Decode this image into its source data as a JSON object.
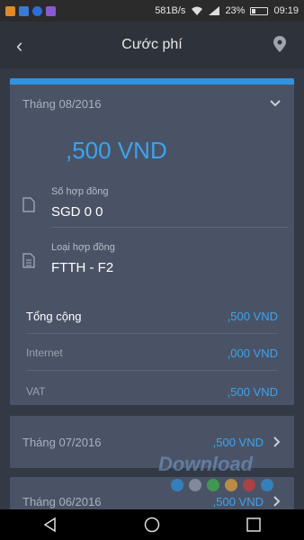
{
  "status_bar": {
    "speed": "581B/s",
    "battery": "23%",
    "time": "09:19"
  },
  "header": {
    "title": "Cước phí"
  },
  "expanded": {
    "month": "Tháng 08/2016",
    "amount": ",500 VND",
    "contract_no_label": "Số hợp đồng",
    "contract_no_value": "SGD   0   0",
    "contract_type_label": "Loại hợp đồng",
    "contract_type_value": "FTTH - F2",
    "total_label": "Tổng cộng",
    "total_value": ",500 VND",
    "internet_label": "Internet",
    "internet_value": ",000 VND",
    "vat_label": "VAT",
    "vat_value": ",500 VND"
  },
  "history": [
    {
      "month": "Tháng 07/2016",
      "amount": ",500 VND"
    },
    {
      "month": "Tháng 06/2016",
      "amount": ",500 VND"
    }
  ],
  "watermark": {
    "text": "Download",
    "colors": [
      "#2f93e0",
      "#9aa1ae",
      "#3fb54a",
      "#e9a33a",
      "#d23a3a",
      "#2f93e0"
    ]
  },
  "colors": {
    "accent": "#2f93e0",
    "card": "#4a5366",
    "background": "#333a46"
  }
}
